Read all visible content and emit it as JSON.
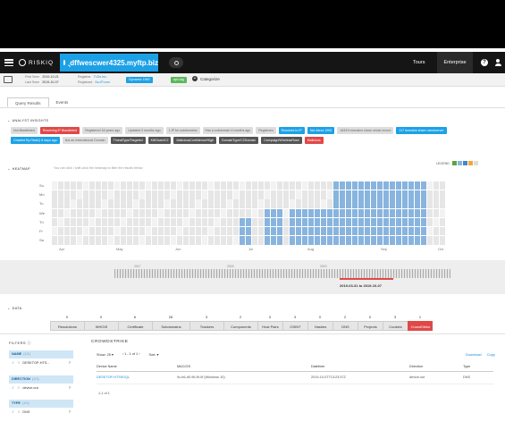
{
  "app": {
    "brand": "RISKIQ",
    "query": "dffwescwer4325.myftp.biz",
    "tours_label": "Tours",
    "enterprise_label": "Enterprise",
    "help_label": "?"
  },
  "summary": {
    "first_seen_label": "First Seen",
    "first_seen": "2019-10-21",
    "last_seen_label": "Last Seen",
    "last_seen": "2019-10-07",
    "registrar_label": "Registrar",
    "registrar": "TLDs Inc.",
    "registrant_label": "Registrant",
    "registrant": "No-IP.com",
    "dns_badge": "Dynamic DNS",
    "tag_badge": "apt-tag",
    "categorize_label": "Categorize"
  },
  "view_tabs": [
    "Query Results",
    "Events"
  ],
  "analyst_insights": {
    "label": "ANALYST INSIGHTS",
    "tags": [
      {
        "text": "Not Blacklisted",
        "style": "gray"
      },
      {
        "text": "Resolving IP Blacklisted",
        "style": "red"
      },
      {
        "text": "Registered 18 years ago",
        "style": "gray"
      },
      {
        "text": "Updated 3 months ago",
        "style": "gray"
      },
      {
        "text": "1 IP for subdomains",
        "style": "gray"
      },
      {
        "text": "Has a subdomain 4 months ago",
        "style": "gray"
      },
      {
        "text": "Registrars",
        "style": "gray"
      },
      {
        "text": "Resolves to IP",
        "style": "blue"
      },
      {
        "text": "Not Alexa 1000",
        "style": "blue"
      },
      {
        "text": "1633% domains share whois record",
        "style": "gray"
      },
      {
        "text": "117 domains share nameserver",
        "style": "blue"
      },
      {
        "text": "Crawled By RiskIQ 8 days ago",
        "style": "blue"
      },
      {
        "text": "Not an International Domain",
        "style": "gray"
      },
      {
        "text": "ThreatType/Targeted",
        "style": "dark"
      },
      {
        "text": "KillChain/C2",
        "style": "dark"
      },
      {
        "text": "MaliciousConfidence/High",
        "style": "dark"
      },
      {
        "text": "DomainType/C2Domain",
        "style": "dark"
      },
      {
        "text": "Campaign/WirelessRose",
        "style": "dark"
      },
      {
        "text": "Malicious",
        "style": "red"
      }
    ]
  },
  "heatmap": {
    "label": "HEATMAP",
    "hint": "You can click / shift-click the heatmap to filter the results below.",
    "legend_label": "LEGEND",
    "legend_colors": [
      "#5fa33b",
      "#88b4de",
      "#4a86c5",
      "#f0a830",
      "#dddddd"
    ],
    "days": [
      "Su",
      "Mo",
      "Tu",
      "We",
      "Th",
      "Fr",
      "Sa"
    ],
    "months": [
      "Apr",
      "May",
      "Jun",
      "Jul",
      "Aug",
      "Sep",
      "Oct"
    ]
  },
  "timeline": {
    "years": [
      "2017",
      "2018",
      "2019"
    ],
    "range_label": "2019-03-31 to 2019-10-07"
  },
  "data_section": {
    "label": "DATA",
    "tabs": [
      {
        "count": "0",
        "label": "Resolutions"
      },
      {
        "count": "0",
        "label": "WHOIS"
      },
      {
        "count": "6",
        "label": "Certificate"
      },
      {
        "count": "26",
        "label": "Subdomains"
      },
      {
        "count": "3",
        "label": "Trackers"
      },
      {
        "count": "2",
        "label": "Components"
      },
      {
        "count": "0",
        "label": "Host Pairs"
      },
      {
        "count": "3",
        "label": "OSINT"
      },
      {
        "count": "0",
        "label": "Hashes"
      },
      {
        "count": "2",
        "label": "DNS"
      },
      {
        "count": "0",
        "label": "Projects"
      },
      {
        "count": "3",
        "label": "Cookies"
      },
      {
        "count": "1",
        "label": "CrowdStrike",
        "active": true
      }
    ]
  },
  "filters": {
    "title": "FILTERS",
    "groups": [
      {
        "name": "NAME",
        "count": "(1/1)",
        "value": "DESKTOP-HTS...",
        "num": "7"
      },
      {
        "name": "DIRECTION",
        "count": "(1/1)",
        "value": "device.out",
        "num": "7"
      },
      {
        "name": "TYPE",
        "count": "(1/1)",
        "value": "DNS",
        "num": "7"
      }
    ]
  },
  "crowdstrike": {
    "title": "CROWDSTRIKE",
    "show_label": "Show: 25",
    "page_label": "1 - 1 of 1",
    "sort_label": "Sort:",
    "download_label": "Download",
    "copy_label": "Copy",
    "columns": [
      "Device Name",
      "MAC/OS",
      "Datetime",
      "Direction",
      "Type"
    ],
    "rows": [
      {
        "device": "DESKTOP-HTS9GQL",
        "macos": "9c-b6-d0-96-f9-0f (Windows 10)",
        "datetime": "2019-10-07T13:23:37Z",
        "direction": "device.out",
        "type": "DNS"
      }
    ],
    "count_label": "1-1 of 1"
  }
}
